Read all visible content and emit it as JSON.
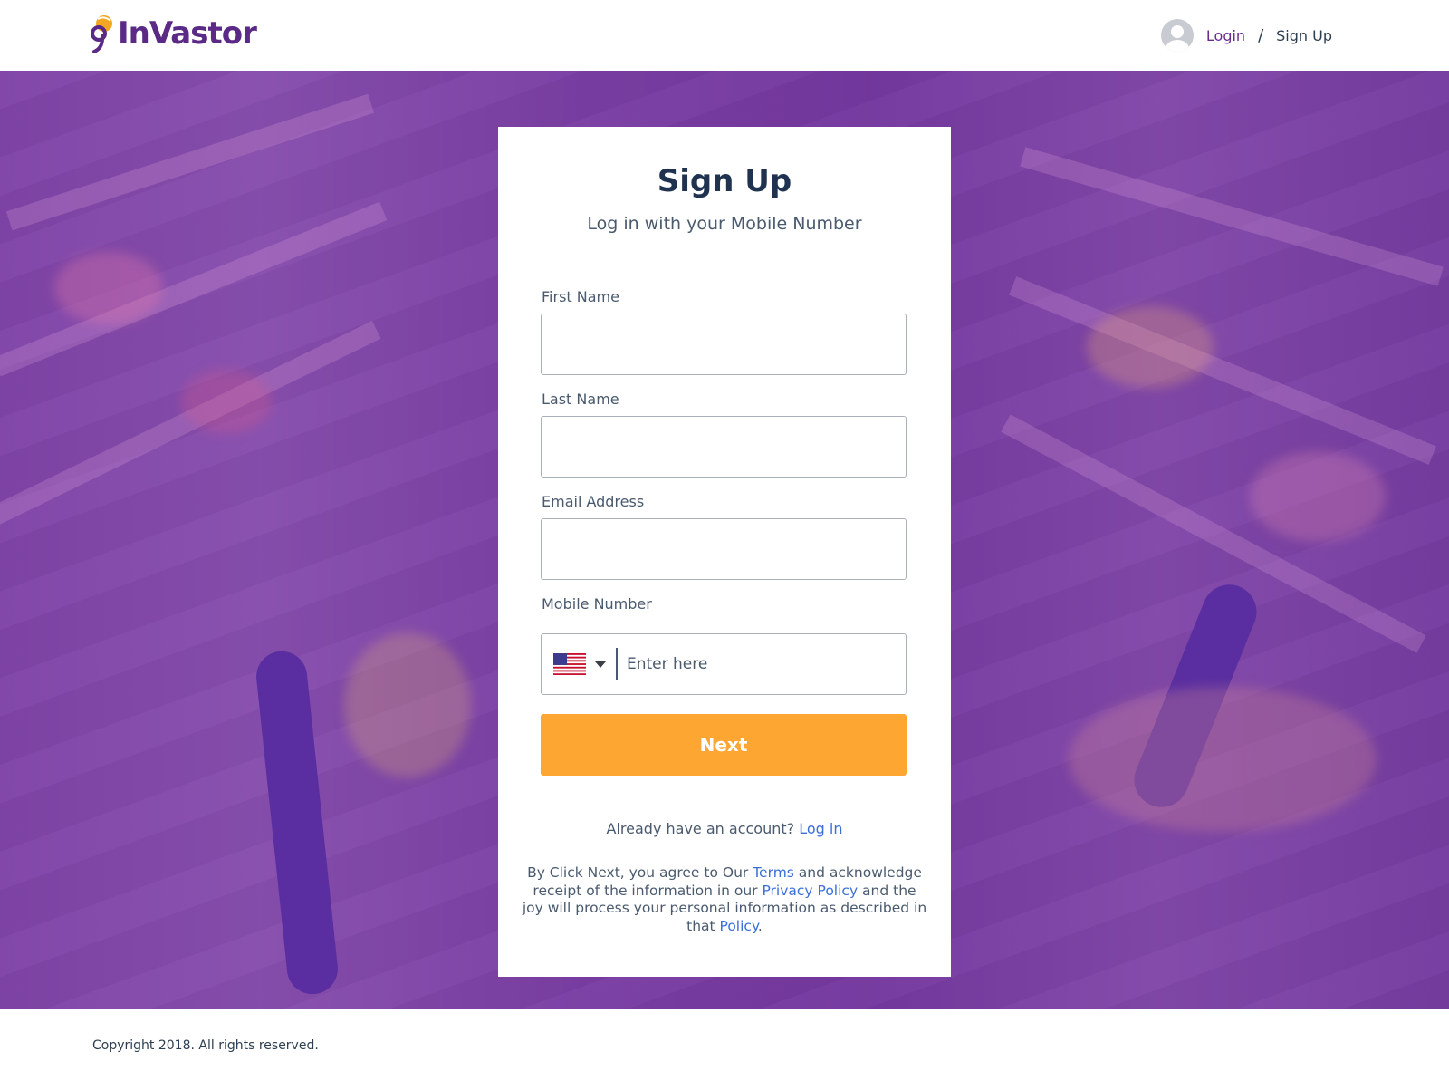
{
  "header": {
    "logo_text": "InVastor",
    "nav": {
      "login_label": "Login",
      "separator": "/",
      "signup_label": "Sign Up"
    }
  },
  "card": {
    "title": "Sign Up",
    "subtitle": "Log in with your Mobile Number",
    "fields": {
      "first_name": {
        "label": "First Name",
        "value": ""
      },
      "last_name": {
        "label": "Last Name",
        "value": ""
      },
      "email": {
        "label": "Email Address",
        "value": ""
      },
      "mobile": {
        "label": "Mobile Number",
        "placeholder": "Enter here",
        "country": "US"
      }
    },
    "next_label": "Next",
    "account_prompt": "Already have an account?",
    "login_link": "Log in",
    "legal": {
      "part1": "By Click Next, you agree to Our ",
      "terms": "Terms",
      "part2": " and acknowledge receipt of the information in our ",
      "privacy": "Privacy Policy",
      "part3": " and the joy will process your personal information as described in that ",
      "policy": "Policy",
      "part4": "."
    }
  },
  "footer": {
    "copyright": "Copyright 2018. All rights reserved."
  },
  "colors": {
    "brand_purple": "#5b2a86",
    "accent_orange": "#fda632",
    "link_blue": "#3a6fd8",
    "overlay_purple": "#7034a0"
  }
}
